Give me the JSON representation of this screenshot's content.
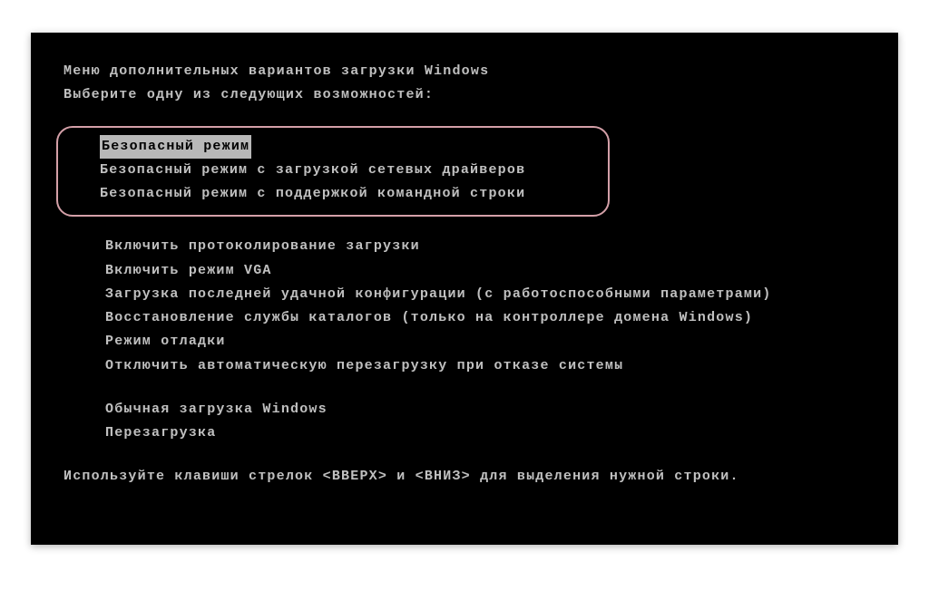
{
  "title": "Меню дополнительных вариантов загрузки Windows",
  "subtitle": "Выберите одну из следующих возможностей:",
  "safe_mode": {
    "option1": "Безопасный режим",
    "option2": "Безопасный режим с загрузкой сетевых драйверов",
    "option3": "Безопасный режим с поддержкой командной строки"
  },
  "group2": {
    "option1": "Включить протоколирование загрузки",
    "option2": "Включить режим VGA",
    "option3": "Загрузка последней удачной конфигурации (с работоспособными параметрами)",
    "option4": "Восстановление службы каталогов (только на контроллере домена Windows)",
    "option5": "Режим отладки",
    "option6": "Отключить автоматическую перезагрузку при отказе системы"
  },
  "group3": {
    "option1": "Обычная загрузка Windows",
    "option2": "Перезагрузка"
  },
  "footer": "Используйте клавиши стрелок <ВВЕРХ> и <ВНИЗ> для выделения нужной строки."
}
